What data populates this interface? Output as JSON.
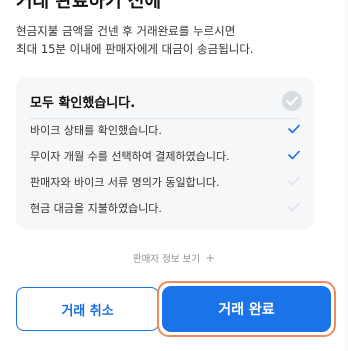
{
  "header": {
    "title_fragment": "거래 완료하기 전에"
  },
  "description": {
    "line1": "현금지불 금액을 건넨 후 거래완료를 누르시면",
    "line2": "최대 15분 이내에 판매자에게 대금이 송금됩니다."
  },
  "checklist": {
    "title": "모두 확인했습니다.",
    "all_checked": false,
    "items": [
      {
        "label": "바이크 상태를 확인했습니다.",
        "checked": true
      },
      {
        "label": "무이자 개월 수를 선택하여 결제하였습니다.",
        "checked": true
      },
      {
        "label": "판매자와 바이크 서류 명의가 동일합니다.",
        "checked": false
      },
      {
        "label": "현금 대금을 지불하였습니다.",
        "checked": false
      }
    ]
  },
  "seller_info": {
    "label": "판매자 정보 보기",
    "icon": "plus-icon"
  },
  "actions": {
    "cancel_label": "거래 취소",
    "confirm_label": "거래 완료"
  },
  "colors": {
    "accent": "#1a73e8",
    "highlight_border": "#f08a5d",
    "check_on": "#1a6fe0",
    "check_off": "#dfe2e6"
  }
}
